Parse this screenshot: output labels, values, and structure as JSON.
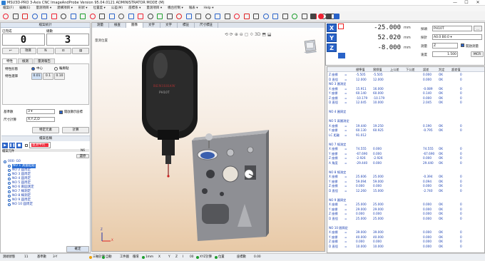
{
  "window": {
    "title": "MSU3D-PRO 3-Axis CNC ImageAndProbe   Version 95.04.0121  ADMINISTRATOR MODE (M)",
    "min": "—",
    "max": "☐",
    "close": "✕"
  },
  "menu": [
    "檔案(F)",
    "編輯(E)",
    "量測項目 ▾",
    "建構項目 ▾",
    "形狀 ▾",
    "位置度 ▾",
    "公差(M)",
    "座標系 ▾",
    "量測項目 ▾",
    "機台控制 ▾",
    "報表 ▾",
    "Help ▾"
  ],
  "left": {
    "counter_title": "檔案統計",
    "counter_left_label": "已完成",
    "counter_right_label": "總數",
    "counter_left_value": "0",
    "counter_right_value": "3",
    "nav_prev": "↩",
    "nav_items": [
      "項目",
      "N",
      "⊡",
      "▤"
    ],
    "tabs": [
      "特性",
      "檢測",
      "量測報告"
    ],
    "meas_mode_label": "特性形態",
    "radio_1": "中心",
    "radio_2": "輪廓點",
    "precision_label": "特性選擇",
    "precision_values": [
      "0.01",
      "0.1",
      "0.10"
    ],
    "base_label": "基準數",
    "base_value": "3 ▾",
    "checkbox_label": "開啟顯示座標",
    "input_label": "尺寸計算",
    "input_value": "X,Y,Z,D",
    "btn_apply": "特定元素",
    "btn_calc": "計算",
    "run_title": "檔案名稱",
    "run_selected": "量測中的...",
    "run_label": "檔案元件",
    "run_value": "N6",
    "run_btn": "還原",
    "tree": [
      {
        "label": "000: G0",
        "type": "root"
      },
      {
        "label": "NO  1  測量起點",
        "sel": true
      },
      {
        "label": "NO  2  圓周定"
      },
      {
        "label": "NO  3  圓周定"
      },
      {
        "label": "NO  4  圓周定"
      },
      {
        "label": "NO  5  圓周定"
      },
      {
        "label": "NO  6  兩圓測定"
      },
      {
        "label": "NO  7  線測定"
      },
      {
        "label": "NO  8  線測定"
      },
      {
        "label": "NO  9  圓周定"
      },
      {
        "label": "NO  10  圓周定"
      }
    ],
    "bottom_btn": "確定"
  },
  "viewport": {
    "tabs": [
      "測量",
      "檢查",
      "圖像",
      "文字",
      "文字",
      "標註",
      "尺寸標註"
    ],
    "label": "量測位置",
    "probe_text_1": "RENISHAW",
    "probe_text_2": "PH10T",
    "threed": "⟐ 3D",
    "axis_x": "X",
    "axis_z": "Z"
  },
  "coords": {
    "x": {
      "axis": "X",
      "value": "-25.000",
      "unit": "mm"
    },
    "y": {
      "axis": "Y",
      "value": "52.020",
      "unit": "mm"
    },
    "z": {
      "axis": "Z",
      "value": "-8.000",
      "unit": "mm"
    },
    "probe_label": "探頭",
    "probe_value": "PH10T",
    "tip_label": "探針",
    "tip_value": "A0.0 B0.0 ▾",
    "plane_label": "測量",
    "plane_value": "Z",
    "check_label": "開啟測量",
    "speed_label": "速度",
    "speed_value": "1.500",
    "unit_btn": "MCR"
  },
  "grid": {
    "headers": [
      "",
      "",
      "",
      "標準值",
      "實際值",
      "上公差",
      "下公差",
      "誤差",
      "判定",
      "超差值"
    ],
    "rows": [
      {
        "t": "Z 座標",
        "v": [
          "-5.505",
          "-5.505",
          "",
          "",
          "0.000",
          "OK",
          "0"
        ]
      },
      {
        "t": "D 直徑",
        "v": [
          "12.000",
          "12.000",
          "",
          "",
          "0.000",
          "OK",
          "0"
        ]
      },
      {
        "t": "NO  3 圓測定",
        "sec": true
      },
      {
        "t": "X 座標",
        "v": [
          "15.911",
          "16.000",
          "",
          "",
          "-0.089",
          "OK",
          "0"
        ]
      },
      {
        "t": "Y 座標",
        "v": [
          "60.140",
          "60.000",
          "",
          "",
          "0.140",
          "OK",
          "0"
        ]
      },
      {
        "t": "Z 座標",
        "v": [
          "-10.179",
          "-10.179",
          "",
          "",
          "0.000",
          "OK",
          "0"
        ]
      },
      {
        "t": "D 直徑",
        "v": [
          "12.045",
          "10.000",
          "",
          "",
          "2.045",
          "OK",
          "0"
        ]
      },
      {
        "t": "",
        "v": [
          "",
          "",
          "",
          "",
          "",
          "",
          ""
        ]
      },
      {
        "t": "NO  4 圓周定",
        "sec": true
      },
      {
        "t": "",
        "v": [
          "",
          "",
          "",
          "",
          "",
          "",
          ""
        ]
      },
      {
        "t": "NO  5 兩圓測定",
        "sec": true
      },
      {
        "t": "X 座標",
        "v": [
          "19.440",
          "19.250",
          "",
          "",
          "0.190",
          "OK",
          "0"
        ]
      },
      {
        "t": "Y 座標",
        "v": [
          "60.130",
          "60.925",
          "",
          "",
          "-0.795",
          "OK",
          "0"
        ]
      },
      {
        "t": "LC 距離",
        "v": [
          "91.012",
          "",
          "",
          "",
          "",
          "",
          ""
        ]
      },
      {
        "t": "",
        "v": [
          "",
          "",
          "",
          "",
          "",
          "",
          ""
        ]
      },
      {
        "t": "NO  7 線測定",
        "sec": true
      },
      {
        "t": "X 座標",
        "v": [
          "74.555",
          "0.000",
          "",
          "",
          "74.555",
          "OK",
          "0"
        ]
      },
      {
        "t": "Y 座標",
        "v": [
          "-67.690",
          "0.000",
          "",
          "",
          "-67.690",
          "OK",
          "0"
        ]
      },
      {
        "t": "Z 座標",
        "v": [
          "-2.926",
          "-2.926",
          "",
          "",
          "0.000",
          "OK",
          "0"
        ]
      },
      {
        "t": "A 角度",
        "v": [
          "-29.440",
          "0.000",
          "",
          "",
          "29.440",
          "OK",
          "0"
        ]
      },
      {
        "t": "",
        "v": [
          "",
          "",
          "",
          "",
          "",
          "",
          ""
        ]
      },
      {
        "t": "NO  8 線測定",
        "sec": true
      },
      {
        "t": "X 座標",
        "v": [
          "25.606",
          "25.000",
          "",
          "",
          "-0.394",
          "OK",
          "0"
        ]
      },
      {
        "t": "Y 座標",
        "v": [
          "59.094",
          "59.000",
          "",
          "",
          "0.094",
          "OK",
          "0"
        ]
      },
      {
        "t": "Z 座標",
        "v": [
          "0.000",
          "0.000",
          "",
          "",
          "0.000",
          "OK",
          "0"
        ]
      },
      {
        "t": "D 直徑",
        "v": [
          "12.260",
          "15.000",
          "",
          "",
          "-2.740",
          "OK",
          "0"
        ]
      },
      {
        "t": "",
        "v": [
          "",
          "",
          "",
          "",
          "",
          "",
          ""
        ]
      },
      {
        "t": "NO  9 圓周定",
        "sec": true
      },
      {
        "t": "X 座標",
        "v": [
          "25.000",
          "25.000",
          "",
          "",
          "0.000",
          "OK",
          "0"
        ]
      },
      {
        "t": "Y 座標",
        "v": [
          "29.000",
          "29.000",
          "",
          "",
          "0.000",
          "OK",
          "0"
        ]
      },
      {
        "t": "Z 座標",
        "v": [
          "0.000",
          "0.000",
          "",
          "",
          "0.000",
          "OK",
          "0"
        ]
      },
      {
        "t": "D 直徑",
        "v": [
          "25.000",
          "25.000",
          "",
          "",
          "0.000",
          "OK",
          "0"
        ]
      },
      {
        "t": "",
        "v": [
          "",
          "",
          "",
          "",
          "",
          "",
          ""
        ]
      },
      {
        "t": "NO  10 圓周定",
        "sec": true
      },
      {
        "t": "X 座標",
        "v": [
          "39.000",
          "39.000",
          "",
          "",
          "0.000",
          "OK",
          "0"
        ]
      },
      {
        "t": "Y 座標",
        "v": [
          "40.000",
          "40.000",
          "",
          "",
          "0.000",
          "OK",
          "0"
        ]
      },
      {
        "t": "Z 座標",
        "v": [
          "0.000",
          "0.000",
          "",
          "",
          "0.000",
          "OK",
          "0"
        ]
      },
      {
        "t": "D 直徑",
        "v": [
          "10.000",
          "10.000",
          "",
          "",
          "0.000",
          "OK",
          "0"
        ]
      }
    ]
  },
  "status": {
    "s1": "測頭狀態",
    "s2": "11",
    "s3": "基準數",
    "s4": "3-Y",
    "items": [
      "三軸計算",
      "自動",
      "工件圖",
      "循環",
      "1mm",
      "X",
      "Y",
      "Z",
      "Ⅰ",
      "00",
      "XYZ計算",
      "位置",
      "座標數",
      "0.00"
    ]
  },
  "colors": {
    "accent": "#2a63c8",
    "selected": "#2a6fd6",
    "ok_green": "#1e9e2e"
  }
}
